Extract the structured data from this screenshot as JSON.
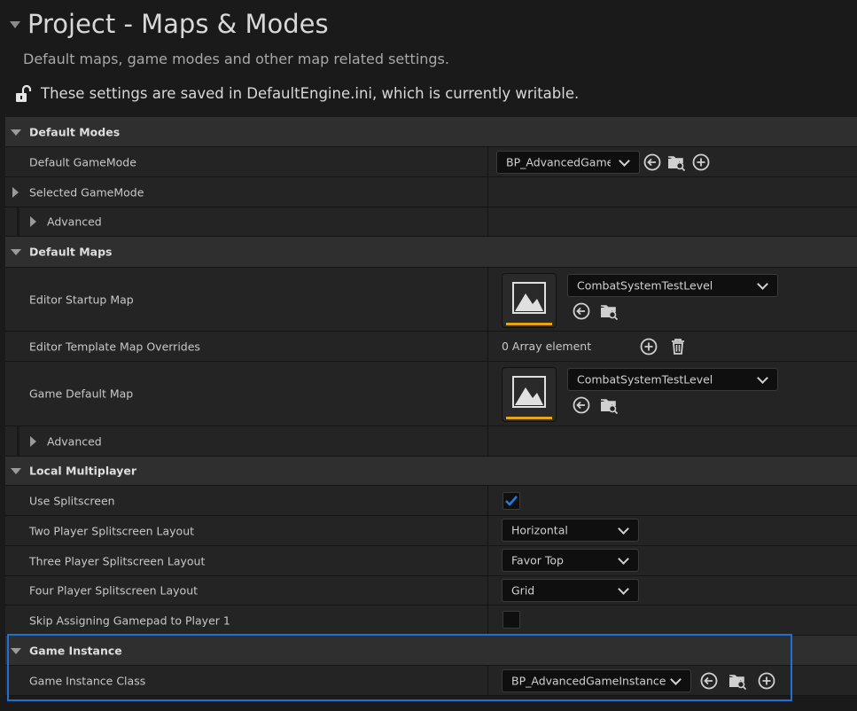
{
  "header": {
    "title": "Project - Maps & Modes",
    "subtitle": "Default maps, game modes and other map related settings.",
    "notice": "These settings are saved in DefaultEngine.ini, which is currently writable."
  },
  "sections": {
    "default_modes": {
      "label": "Default Modes",
      "default_gamemode": {
        "label": "Default GameMode",
        "value": "BP_AdvancedGameMode"
      },
      "selected_gamemode": {
        "label": "Selected GameMode"
      },
      "advanced": {
        "label": "Advanced"
      }
    },
    "default_maps": {
      "label": "Default Maps",
      "editor_startup_map": {
        "label": "Editor Startup Map",
        "value": "CombatSystemTestLevel"
      },
      "editor_template_overrides": {
        "label": "Editor Template Map Overrides",
        "value": "0 Array element"
      },
      "game_default_map": {
        "label": "Game Default Map",
        "value": "CombatSystemTestLevel"
      },
      "advanced": {
        "label": "Advanced"
      }
    },
    "local_multiplayer": {
      "label": "Local Multiplayer",
      "use_splitscreen": {
        "label": "Use Splitscreen",
        "checked": true
      },
      "two_player": {
        "label": "Two Player Splitscreen Layout",
        "value": "Horizontal"
      },
      "three_player": {
        "label": "Three Player Splitscreen Layout",
        "value": "Favor Top"
      },
      "four_player": {
        "label": "Four Player Splitscreen Layout",
        "value": "Grid"
      },
      "skip_gamepad": {
        "label": "Skip Assigning Gamepad to Player 1",
        "checked": false
      }
    },
    "game_instance": {
      "label": "Game Instance",
      "class": {
        "label": "Game Instance Class",
        "value": "BP_AdvancedGameInstance"
      }
    }
  },
  "colors": {
    "accent_highlight": "#1f6fd6",
    "thumbnail_bar": "#e8a317",
    "check": "#1f7fe0"
  }
}
